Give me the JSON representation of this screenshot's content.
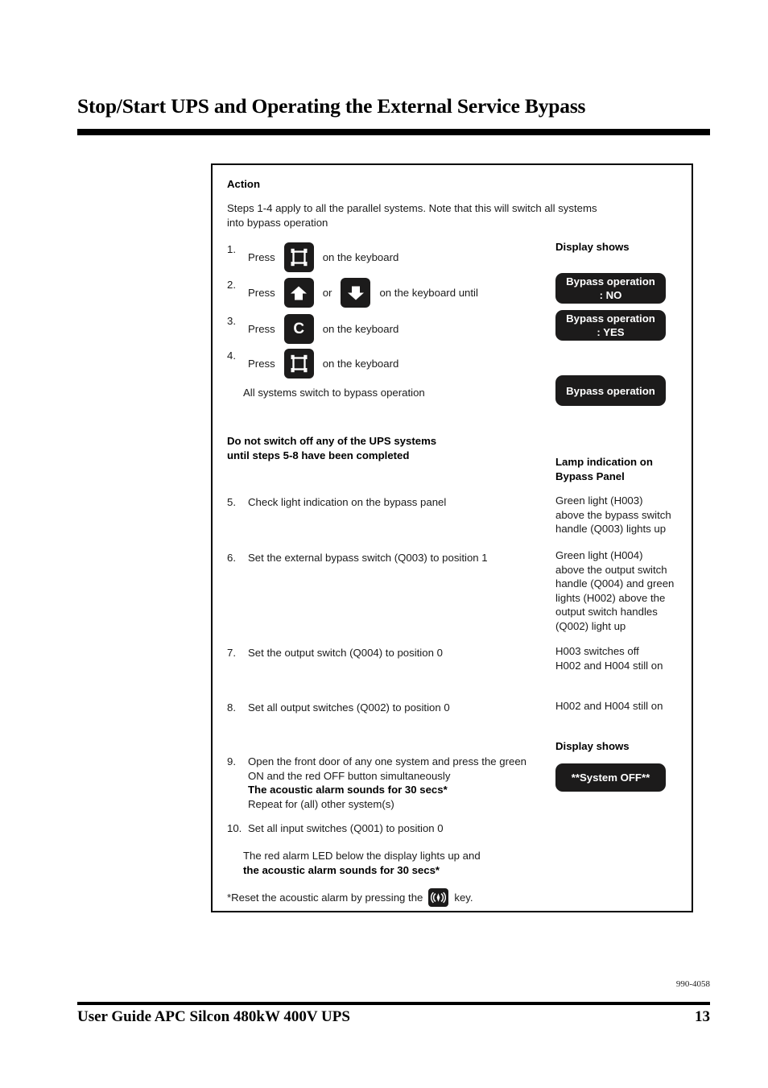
{
  "page": {
    "title": "Stop/Start UPS and Operating the External Service Bypass",
    "doc_number": "990-4058",
    "footer_text": "User Guide APC Silcon 480kW 400V UPS",
    "page_number": "13"
  },
  "procedure": {
    "action_heading": "Action",
    "intro": "Steps 1-4 apply to all the parallel systems. Note that this will switch all systems\ninto bypass operation",
    "display_shows_heading_1": "Display shows",
    "steps_1_4": [
      {
        "num": "1.",
        "press_word": "Press",
        "key": "frame-key",
        "tail": "on the keyboard"
      },
      {
        "num": "2.",
        "press_word": "Press",
        "key": "arrow-up-key",
        "conjunction": "or",
        "key2": "arrow-down-key",
        "tail": "on the keyboard until"
      },
      {
        "num": "3.",
        "press_word": "Press",
        "key": "c-key",
        "key_letter": "C",
        "tail": "on the keyboard"
      },
      {
        "num": "4.",
        "press_word": "Press",
        "key": "frame-key",
        "tail": "on the keyboard"
      }
    ],
    "after_step4_note": "All systems switch to bypass operation",
    "lcd_bypass_no": {
      "line1": "Bypass operation",
      "line2": ": NO"
    },
    "lcd_bypass_yes": {
      "line1": "Bypass operation",
      "line2": ": YES"
    },
    "lcd_bypass_plain": {
      "line1": "Bypass operation"
    },
    "warning": "Do not switch off any of the UPS systems\nuntil steps 5-8 have been completed",
    "lamp_heading": "Lamp indication on\nBypass Panel",
    "steps_5_8": [
      {
        "num": "5.",
        "text": "Check light indication on the bypass panel",
        "result": "Green light (H003)\nabove the bypass switch\nhandle (Q003) lights up"
      },
      {
        "num": "6.",
        "text": "Set the external bypass switch (Q003) to position 1",
        "result": "Green light (H004)\nabove the output switch\nhandle (Q004) and green\nlights (H002) above the\noutput switch handles\n(Q002) light up"
      },
      {
        "num": "7.",
        "text": "Set the output switch (Q004) to position 0",
        "result": "H003 switches off\nH002 and H004 still on"
      },
      {
        "num": "8.",
        "text": "Set all output switches (Q002) to position 0",
        "result": "H002 and H004 still on"
      }
    ],
    "display_shows_heading_2": "Display shows",
    "step_9": {
      "num": "9.",
      "line1": "Open the front door of any one system and press the green",
      "line2": "ON and the red OFF button simultaneously",
      "line3_bold": "The acoustic alarm sounds for 30 secs*",
      "line4": "Repeat for (all) other system(s)"
    },
    "lcd_system_off": {
      "line1": "**System OFF**"
    },
    "step_10": {
      "num": "10.",
      "text": "Set all input switches (Q001) to position 0"
    },
    "step_10_result_line1": "The red alarm LED below the display lights up and",
    "step_10_result_line2_bold": "the acoustic alarm sounds for 30 secs*",
    "footnote_before": "*Reset the acoustic alarm by pressing the",
    "footnote_key": "alarm-bell-key",
    "footnote_after": "key."
  },
  "colors": {
    "key_black": "#1c1b1b",
    "text": "#1a1a1a",
    "rule": "#000000"
  }
}
